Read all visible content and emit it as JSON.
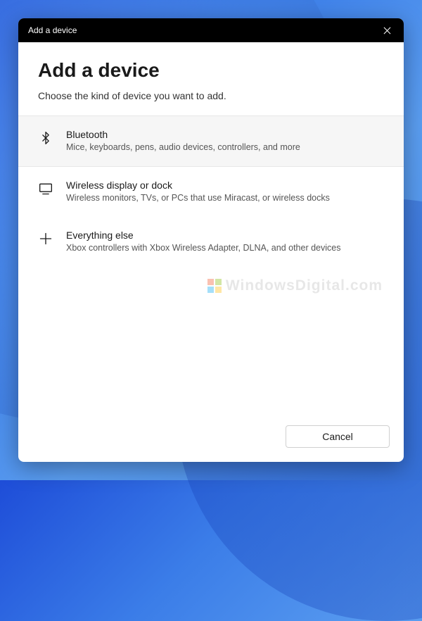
{
  "titlebar": {
    "title": "Add a device"
  },
  "header": {
    "title": "Add a device",
    "subtitle": "Choose the kind of device you want to add."
  },
  "options": [
    {
      "icon": "bluetooth",
      "title": "Bluetooth",
      "description": "Mice, keyboards, pens, audio devices, controllers, and more",
      "hovered": true
    },
    {
      "icon": "display",
      "title": "Wireless display or dock",
      "description": "Wireless monitors, TVs, or PCs that use Miracast, or wireless docks",
      "hovered": false
    },
    {
      "icon": "plus",
      "title": "Everything else",
      "description": "Xbox controllers with Xbox Wireless Adapter, DLNA, and other devices",
      "hovered": false
    }
  ],
  "footer": {
    "cancel_label": "Cancel"
  },
  "watermark": {
    "text": "WindowsDigital.com"
  }
}
